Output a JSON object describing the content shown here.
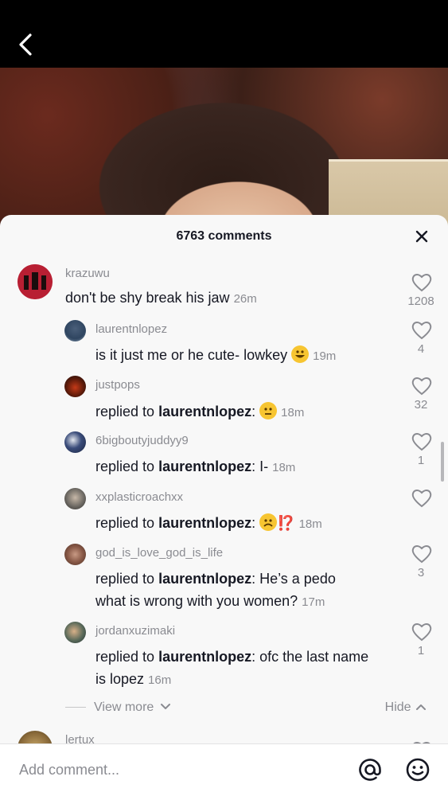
{
  "header": {
    "back_icon": "chevron-left-icon"
  },
  "sheet": {
    "title": "6763 comments",
    "close_icon": "close-icon"
  },
  "comments": [
    {
      "username": "krazuwu",
      "text": "don't be shy break his jaw",
      "time": "26m",
      "likes": "1208"
    },
    {
      "username": "laurentnlopez",
      "text": "is it just me or he cute- lowkey",
      "emoji": "grinning-face",
      "time": "19m",
      "likes": "4"
    },
    {
      "username": "justpops",
      "prefix": "replied to",
      "reply_to": "laurentnlopez",
      "text": ":",
      "emoji": "neutral-face",
      "time": "18m",
      "likes": "32"
    },
    {
      "username": "6bigboutyjuddyy9",
      "prefix": "replied to",
      "reply_to": "laurentnlopez",
      "text": ": I-",
      "time": "18m",
      "likes": "1"
    },
    {
      "username": "xxplasticroachxx",
      "prefix": "replied to",
      "reply_to": "laurentnlopez",
      "text": ":",
      "emoji": "frowning-face",
      "emoji2": "⁉️",
      "time": "18m",
      "likes": ""
    },
    {
      "username": "god_is_love_god_is_life",
      "prefix": "replied to",
      "reply_to": "laurentnlopez",
      "text": ": He’s a pedo",
      "text2": "what is wrong with you women?",
      "time": "17m",
      "likes": "3"
    },
    {
      "username": "jordanxuzimaki",
      "prefix": "replied to",
      "reply_to": "laurentnlopez",
      "text": ": ofc the last name",
      "text2": "is lopez",
      "time": "16m",
      "likes": "1"
    }
  ],
  "next_comment": {
    "username": "lertux"
  },
  "footer": {
    "view_more": "View more",
    "hide": "Hide"
  },
  "input": {
    "placeholder": "Add comment...",
    "mention_icon": "at-icon",
    "emoji_icon": "smile-icon"
  },
  "colors": {
    "sheet_bg": "#f8f8f8",
    "muted": "#8a8b91",
    "text": "#161823"
  }
}
